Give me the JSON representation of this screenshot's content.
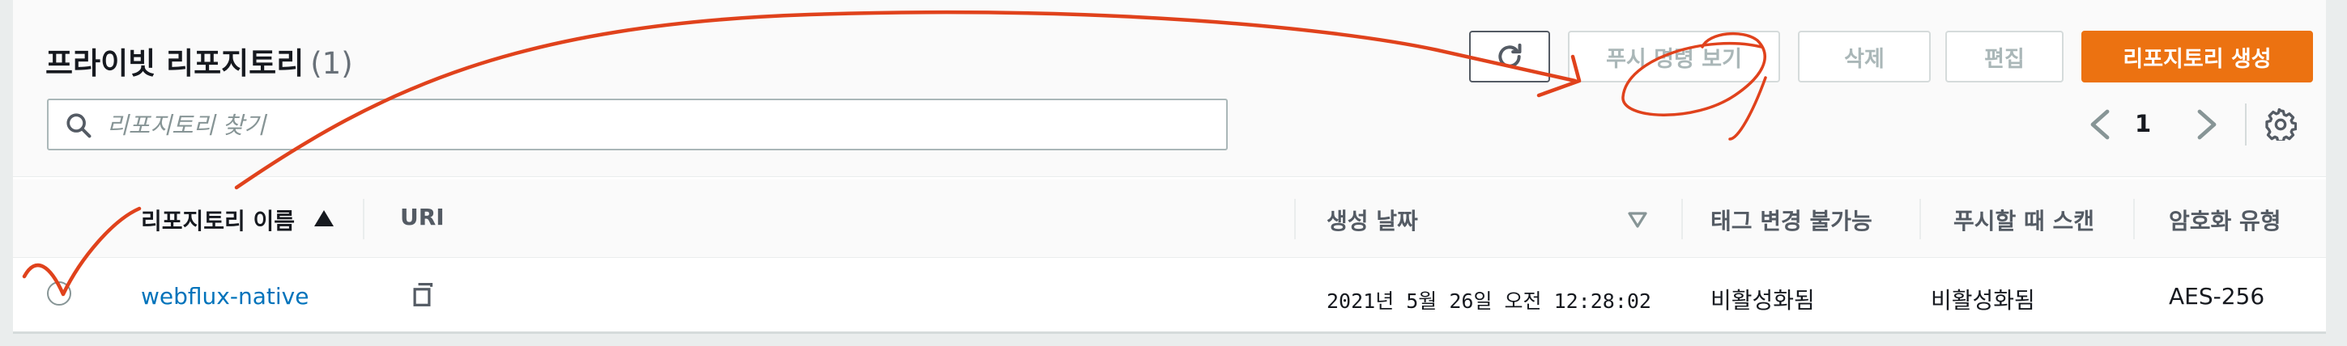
{
  "header": {
    "title": "프라이빗 리포지토리",
    "count": "(1)"
  },
  "toolbar": {
    "refresh_icon": "refresh-icon",
    "push_label": "푸시 명령 보기",
    "delete_label": "삭제",
    "edit_label": "편집",
    "create_label": "리포지토리 생성"
  },
  "search": {
    "placeholder": "리포지토리 찾기",
    "value": ""
  },
  "pagination": {
    "current_page": "1"
  },
  "table": {
    "columns": [
      "리포지토리 이름",
      "URI",
      "생성 날짜",
      "태그 변경 불가능",
      "푸시할 때 스캔",
      "암호화 유형"
    ],
    "rows": [
      {
        "name": "webflux-native",
        "created": "2021년 5월 26일 오전 12:28:02",
        "tag_immutability": "비활성화됨",
        "scan_on_push": "비활성화됨",
        "encryption": "AES-256"
      }
    ]
  },
  "colors": {
    "primary_button": "#ec7211",
    "link": "#0073bb",
    "annotation": "#e0421c"
  }
}
